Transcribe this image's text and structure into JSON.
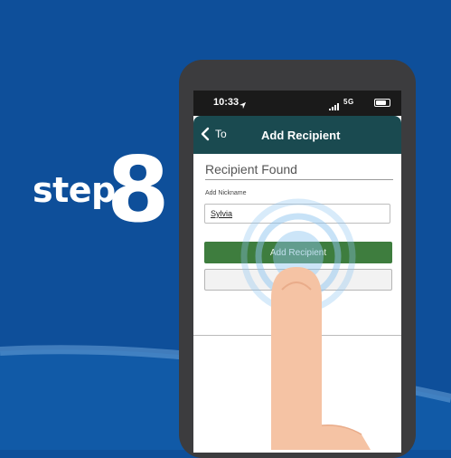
{
  "step": {
    "label": "step",
    "number": "8"
  },
  "status_bar": {
    "time": "10:33",
    "network": "5G"
  },
  "nav": {
    "back_label": "To",
    "title": "Add Recipient"
  },
  "form": {
    "heading": "Recipient Found",
    "nickname_label": "Add Nickname",
    "nickname_value": "Sylvia",
    "add_button_label": "Add Recipient"
  },
  "colors": {
    "background": "#0e4f9a",
    "nav_bar": "#1a4a50",
    "add_button": "#3e7d3e",
    "ripple": "#8fc6f0",
    "finger": "#f5c3a4"
  },
  "icons": [
    "location-arrow-icon",
    "signal-icon",
    "battery-icon",
    "chevron-left-icon"
  ]
}
